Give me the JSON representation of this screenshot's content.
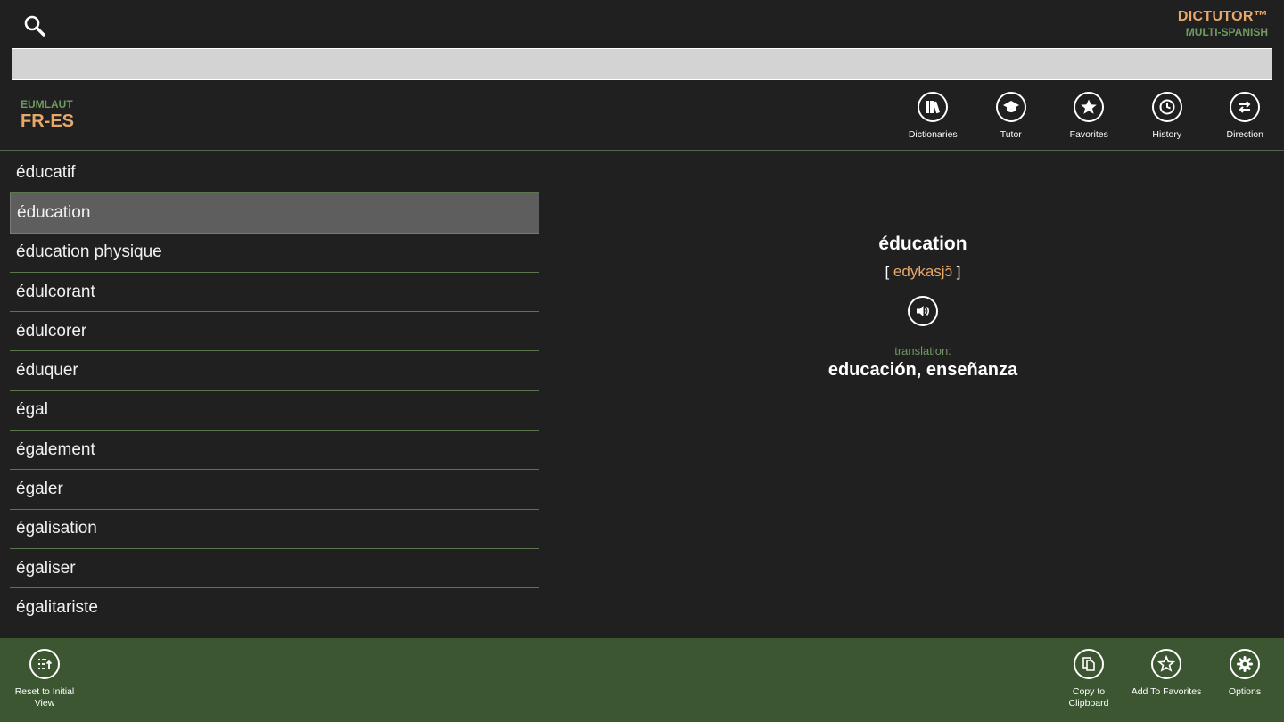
{
  "header": {
    "search_icon": "search-icon",
    "brand_name": "DICTUTOR™",
    "brand_sub": "MULTI-SPANISH",
    "search_placeholder": "",
    "search_value": ""
  },
  "dictionary": {
    "code": "EUMLAUT",
    "pair": "FR-ES"
  },
  "toolbar": [
    {
      "label": "Dictionaries",
      "icon": "books-icon"
    },
    {
      "label": "Tutor",
      "icon": "graduation-cap-icon"
    },
    {
      "label": "Favorites",
      "icon": "star-icon"
    },
    {
      "label": "History",
      "icon": "clock-icon"
    },
    {
      "label": "Direction",
      "icon": "swap-arrows-icon"
    }
  ],
  "word_list": {
    "items": [
      "éducatif",
      "éducation",
      "éducation physique",
      "édulcorant",
      "édulcorer",
      "éduquer",
      "égal",
      "également",
      "égaler",
      "égalisation",
      "égaliser",
      "égalitariste"
    ],
    "selected_index": 1
  },
  "entry": {
    "headword": "éducation",
    "bracket_open": "[",
    "phonetic": "edykasjɔ̃",
    "bracket_close": "]",
    "speaker_icon": "speaker-icon",
    "translation_label": "translation:",
    "translation": "educación, enseñanza"
  },
  "appbar": {
    "left": [
      {
        "label": "Reset to Initial View",
        "icon": "list-reset-icon"
      }
    ],
    "right": [
      {
        "label": "Copy to Clipboard",
        "icon": "copy-icon"
      },
      {
        "label": "Add To Favorites",
        "icon": "star-add-icon"
      },
      {
        "label": "Options",
        "icon": "gear-icon"
      }
    ]
  },
  "colors": {
    "background": "#202020",
    "accent_orange": "#e8a86a",
    "accent_green": "#6f9a63",
    "appbar": "#3c5632",
    "selected_row": "#5e5e5e"
  }
}
